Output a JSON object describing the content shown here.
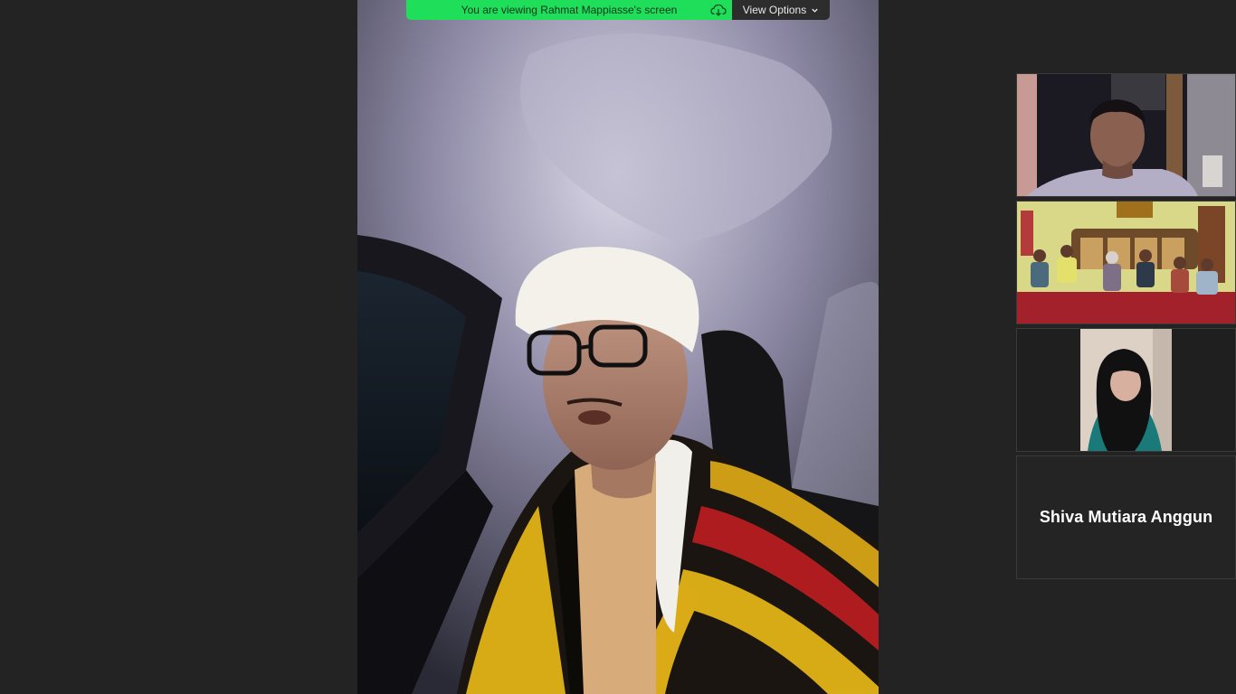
{
  "banner": {
    "message": "You are viewing Rahmat Mappiasse's screen",
    "view_options_label": "View Options",
    "color": "#1fdf5a"
  },
  "main_video": {
    "icon": "video-feed"
  },
  "participants": [
    {
      "kind": "video",
      "icon": "participant-video"
    },
    {
      "kind": "video",
      "icon": "participant-video"
    },
    {
      "kind": "video",
      "icon": "participant-video"
    },
    {
      "kind": "name",
      "name": "Shiva Mutiara Anggun"
    }
  ]
}
